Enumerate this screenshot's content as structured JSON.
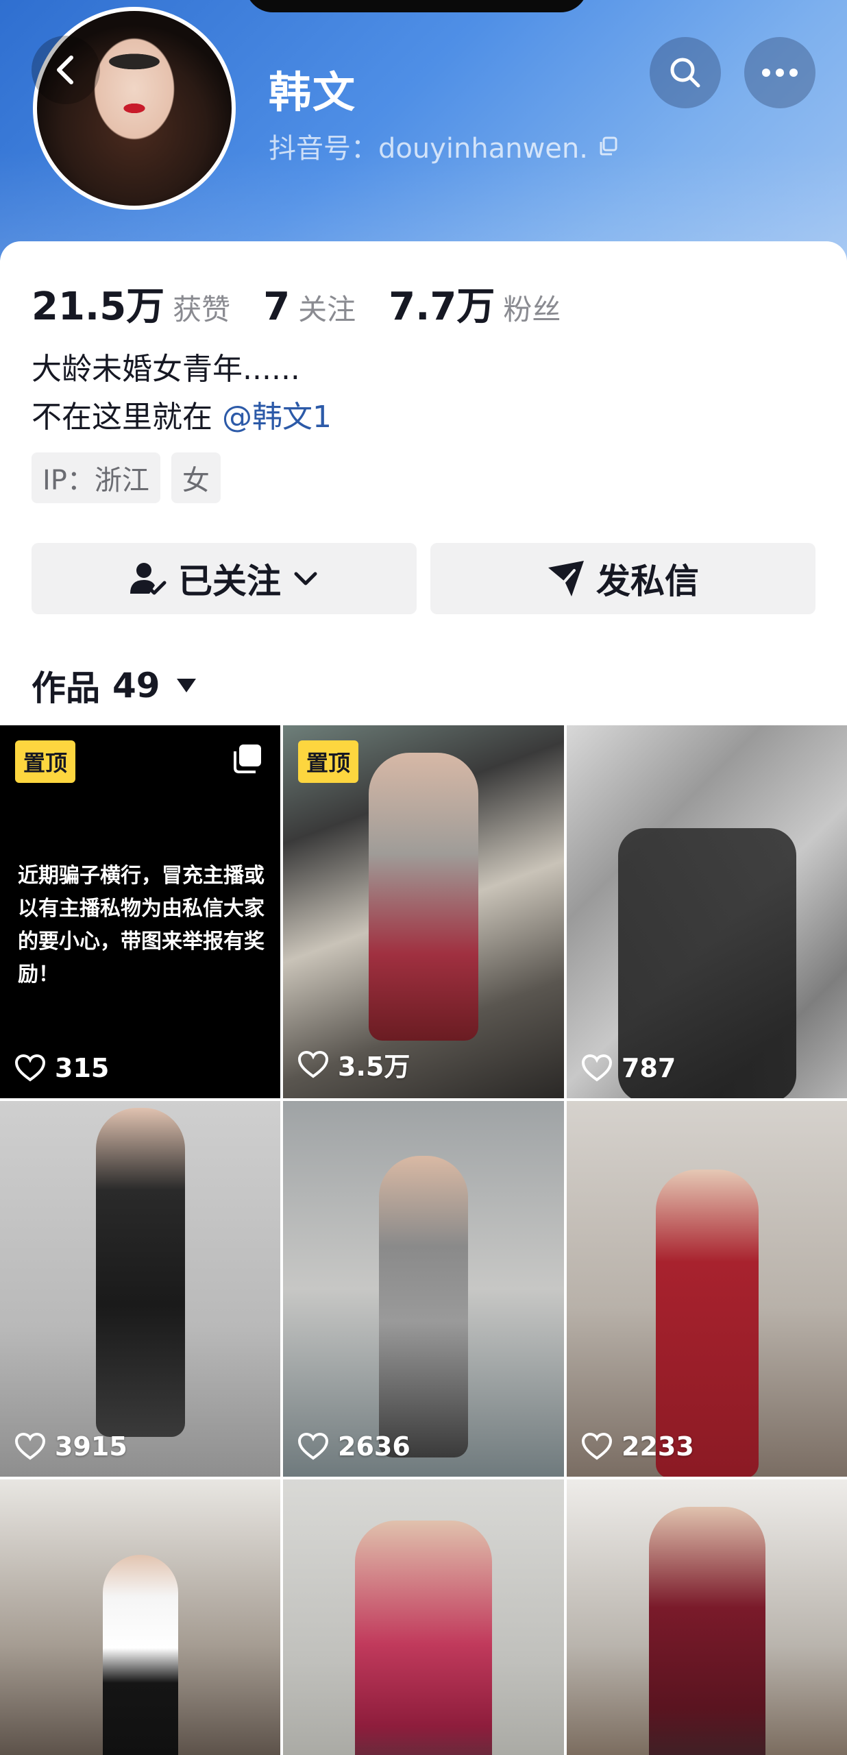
{
  "profile": {
    "name": "韩文",
    "douyin_id": "抖音号：douyinhanwen."
  },
  "stats": [
    {
      "value": "21.5万",
      "label": "获赞"
    },
    {
      "value": "7",
      "label": "关注"
    },
    {
      "value": "7.7万",
      "label": "粉丝"
    }
  ],
  "bio": {
    "line1": "大龄未婚女青年......",
    "line2_prefix": "不在这里就在 ",
    "mention": "@韩文1"
  },
  "tags": [
    "IP：浙江",
    "女"
  ],
  "actions": {
    "followed_label": "已关注",
    "message_label": "发私信"
  },
  "works": {
    "label": "作品",
    "count": "49"
  },
  "grid": [
    {
      "pinned": "置顶",
      "likes": "315",
      "notice": "近期骗子横行，冒充主播或以有主播私物为由私信大家的要小心，带图来举报有奖励！"
    },
    {
      "pinned": "置顶",
      "likes": "3.5万"
    },
    {
      "likes": "787"
    },
    {
      "likes": "3915"
    },
    {
      "likes": "2636"
    },
    {
      "likes": "2233"
    },
    {},
    {},
    {}
  ],
  "colors": {
    "header_gradient_start": "#2f6fd0",
    "pin_badge": "#fdd63f",
    "mention": "#2c5aa8"
  },
  "icons": [
    "back-icon",
    "search-icon",
    "more-icon",
    "copy-icon",
    "followed-user-icon",
    "chevron-down-icon",
    "send-icon",
    "caret-down-icon",
    "multi-image-icon",
    "heart-icon"
  ]
}
